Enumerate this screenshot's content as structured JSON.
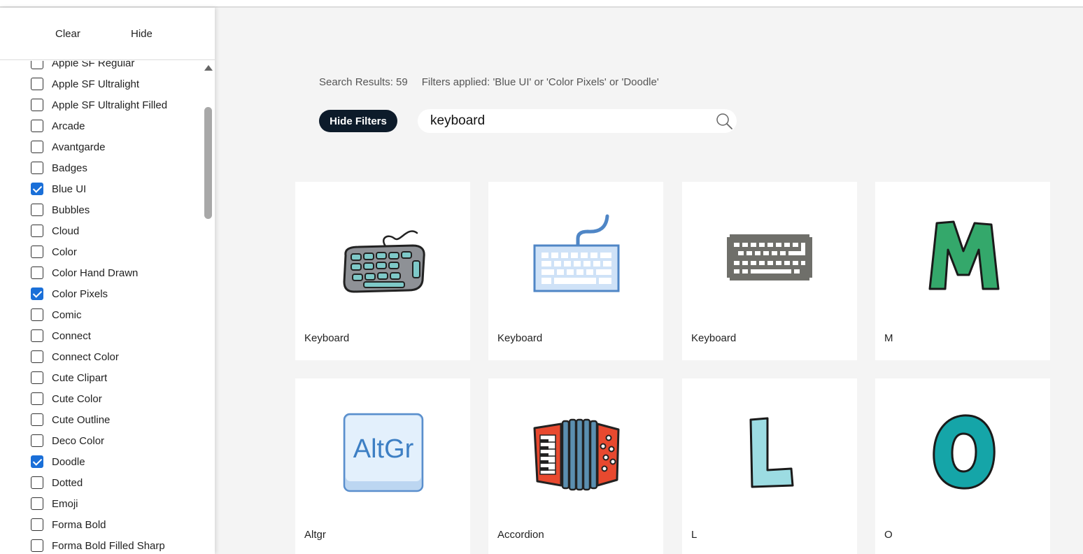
{
  "sidebar": {
    "clear_label": "Clear",
    "hide_label": "Hide",
    "partial_item": "Apple SF Regular",
    "items": [
      {
        "label": "Apple SF Ultralight",
        "checked": false
      },
      {
        "label": "Apple SF Ultralight Filled",
        "checked": false
      },
      {
        "label": "Arcade",
        "checked": false
      },
      {
        "label": "Avantgarde",
        "checked": false
      },
      {
        "label": "Badges",
        "checked": false
      },
      {
        "label": "Blue UI",
        "checked": true
      },
      {
        "label": "Bubbles",
        "checked": false
      },
      {
        "label": "Cloud",
        "checked": false
      },
      {
        "label": "Color",
        "checked": false
      },
      {
        "label": "Color Hand Drawn",
        "checked": false
      },
      {
        "label": "Color Pixels",
        "checked": true
      },
      {
        "label": "Comic",
        "checked": false
      },
      {
        "label": "Connect",
        "checked": false
      },
      {
        "label": "Connect Color",
        "checked": false
      },
      {
        "label": "Cute Clipart",
        "checked": false
      },
      {
        "label": "Cute Color",
        "checked": false
      },
      {
        "label": "Cute Outline",
        "checked": false
      },
      {
        "label": "Deco Color",
        "checked": false
      },
      {
        "label": "Doodle",
        "checked": true
      },
      {
        "label": "Dotted",
        "checked": false
      },
      {
        "label": "Emoji",
        "checked": false
      },
      {
        "label": "Forma Bold",
        "checked": false
      },
      {
        "label": "Forma Bold Filled Sharp",
        "checked": false
      }
    ]
  },
  "results": {
    "count_text": "Search Results: 59",
    "filters_text": "Filters applied: 'Blue UI' or 'Color Pixels' or 'Doodle'"
  },
  "toolbar": {
    "hide_filters_label": "Hide Filters"
  },
  "search": {
    "value": "keyboard"
  },
  "cards": [
    {
      "title": "Keyboard",
      "icon": "doodle-keyboard-icon"
    },
    {
      "title": "Keyboard",
      "icon": "blue-ui-keyboard-icon"
    },
    {
      "title": "Keyboard",
      "icon": "pixel-keyboard-icon"
    },
    {
      "title": "M",
      "icon": "letter-m-icon"
    },
    {
      "title": "Altgr",
      "icon": "altgr-key-icon",
      "key_text": "AltGr"
    },
    {
      "title": "Accordion",
      "icon": "accordion-icon"
    },
    {
      "title": "L",
      "icon": "letter-l-icon"
    },
    {
      "title": "O",
      "icon": "letter-o-icon"
    }
  ],
  "colors": {
    "accent": "#1a6fd8",
    "hide_filters_bg": "#0d1b2a",
    "page_bg": "#f4f4f4"
  }
}
